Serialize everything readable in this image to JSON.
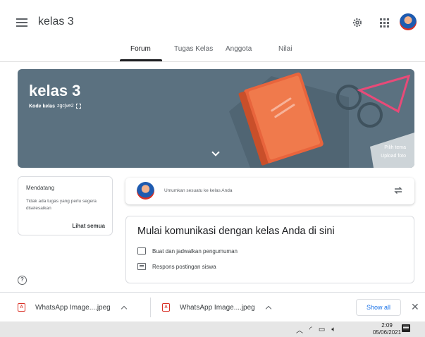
{
  "header": {
    "title": "kelas 3",
    "menu_icon": "hamburger-menu-icon",
    "settings_icon": "gear-icon",
    "apps_icon": "apps-grid-icon"
  },
  "tabs": [
    {
      "label": "Forum",
      "active": true
    },
    {
      "label": "Tugas Kelas",
      "active": false
    },
    {
      "label": "Anggota",
      "active": false
    },
    {
      "label": "Nilai",
      "active": false
    }
  ],
  "banner": {
    "title": "kelas 3",
    "code_label": "Kode kelas",
    "code_value": "zgcjve2",
    "select_theme": "Pilih tema",
    "upload_photo": "Upload foto",
    "color": "#5b7180"
  },
  "upcoming": {
    "title": "Mendatang",
    "text": "Tidak ada tugas yang perlu segera diselesaikan",
    "link": "Lihat semua"
  },
  "announce": {
    "placeholder": "Umumkan sesuatu ke kelas Anda"
  },
  "communicate": {
    "title": "Mulai komunikasi dengan kelas Anda di sini",
    "items": [
      {
        "label": "Buat dan jadwalkan pengumuman",
        "icon": "announcement-icon"
      },
      {
        "label": "Respons postingan siswa",
        "icon": "comment-icon"
      }
    ]
  },
  "downloads": {
    "files": [
      {
        "name": "WhatsApp Image....jpeg"
      },
      {
        "name": "WhatsApp Image....jpeg"
      }
    ],
    "show_all": "Show all"
  },
  "taskbar": {
    "time": "2:09",
    "date": "05/06/2021"
  },
  "colors": {
    "accent": "#1a73e8",
    "pdf_red": "#d93025"
  }
}
